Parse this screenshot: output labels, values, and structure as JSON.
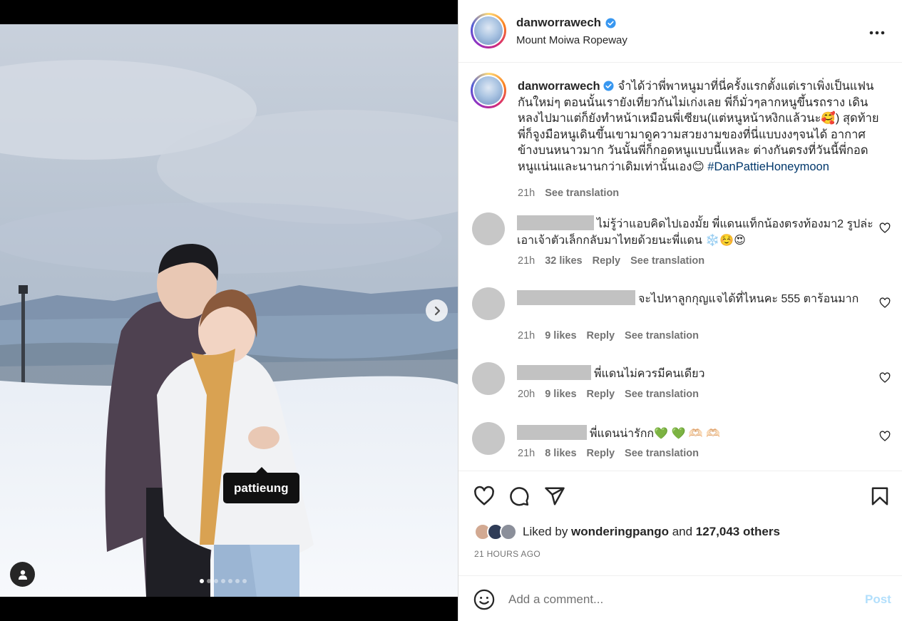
{
  "post": {
    "username": "danworrawech",
    "location": "Mount Moiwa Ropeway",
    "more_icon": "more-horizontal-icon",
    "verified_color": "#3897f0"
  },
  "media": {
    "tag_label": "pattieung",
    "carousel_count": 7,
    "carousel_active_index": 0
  },
  "caption": {
    "username": "danworrawech",
    "text": "จำได้ว่าพี่พาหนูมาที่นี่ครั้งแรกตั้งแต่เราเพิ่งเป็นแฟนกันใหม่ๆ ตอนนั้นเรายังเที่ยวกันไม่เก่งเลย พี่ก็มั่วๆลากหนูขึ้นรถราง เดินหลงไปมาแต่ก็ยังทำหน้าเหมือนพี่เซียน(แต่หนูหน้าหงิกแล้วนะ🥰) สุดท้ายพี่ก็จูงมือหนูเดินขึ้นเขามาดูความสวยงามของที่นี่แบบงงๆจนได้ อากาศข้างบนหนาวมาก วันนั้นพี่ก็กอดหนูแบบนี้แหละ ต่างกันตรงที่วันนี้พี่กอดหนูแน่นและนานกว่าเดิมเท่านั้นเอง😊 ",
    "hashtag": "#DanPattieHoneymoon",
    "time": "21h",
    "see_translation": "See translation"
  },
  "comments": [
    {
      "text": "ไม่รู้ว่าแอบคิดไปเองมั้ย พี่แดนแท็กน้องตรงท้องมา2 รูปล่ะ เอาเจ้าตัวเล็กกลับมาไทยด้วยนะพี่แดน ❄️☺️😍",
      "time": "21h",
      "likes": "32 likes",
      "reply": "Reply",
      "translate": "See translation"
    },
    {
      "text": "จะไปหาลูกกุญแจได้ที่ไหนคะ 555 ตาร้อนมาก",
      "time": "21h",
      "likes": "9 likes",
      "reply": "Reply",
      "translate": "See translation"
    },
    {
      "text": "พี่แดนไม่ควรมีคนเดียว",
      "time": "20h",
      "likes": "9 likes",
      "reply": "Reply",
      "translate": "See translation"
    },
    {
      "text": "พี่แดนน่ารักก💚 💚 🫶🏻 🫶🏻",
      "time": "21h",
      "likes": "8 likes",
      "reply": "Reply",
      "translate": "See translation"
    }
  ],
  "actions": {
    "like_icon": "heart-icon",
    "comment_icon": "comment-icon",
    "share_icon": "share-icon",
    "save_icon": "bookmark-icon"
  },
  "likes": {
    "prefix": "Liked by ",
    "user": "wonderingpango",
    "middle": " and ",
    "count": "127,043 others"
  },
  "timestamp": "21 HOURS AGO",
  "add_comment": {
    "placeholder": "Add a comment...",
    "post_label": "Post"
  }
}
